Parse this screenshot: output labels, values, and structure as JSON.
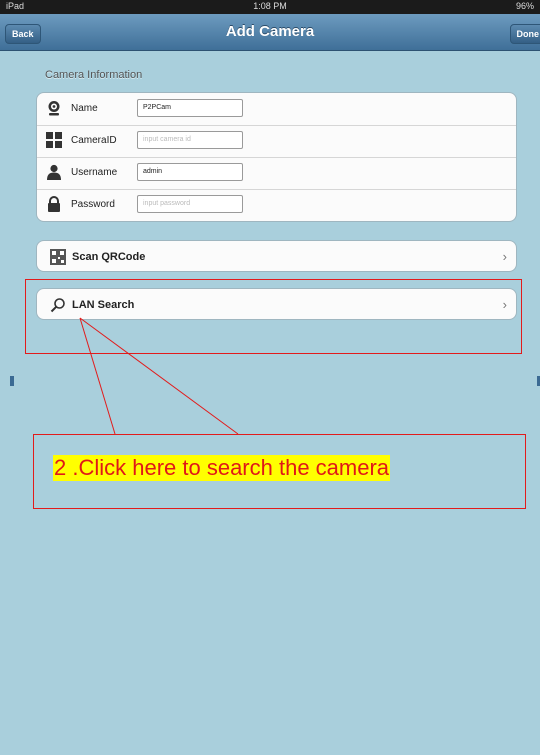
{
  "status_bar": {
    "left": "iPad",
    "center": "1:08 PM",
    "right": "96%"
  },
  "nav": {
    "title": "Add Camera",
    "back_label": "Back",
    "done_label": "Done"
  },
  "form": {
    "section_title": "Camera Information",
    "rows": [
      {
        "label": "Name",
        "value": "P2PCam",
        "placeholder": "",
        "icon": "webcam-icon"
      },
      {
        "label": "CameraID",
        "value": "",
        "placeholder": "input camera id",
        "icon": "qrcode-icon"
      },
      {
        "label": "Username",
        "value": "admin",
        "placeholder": "",
        "icon": "user-icon"
      },
      {
        "label": "Password",
        "value": "",
        "placeholder": "input password",
        "icon": "lock-icon"
      }
    ]
  },
  "actions": {
    "scan_qrcode": {
      "label": "Scan QRCode",
      "icon": "qrcode-icon"
    },
    "lan_search": {
      "label": "LAN Search",
      "icon": "magnifier-icon"
    }
  },
  "annotation": {
    "text": "2 .Click here to search the camera",
    "color": "#e21b1b",
    "highlight": "#ffff00"
  }
}
